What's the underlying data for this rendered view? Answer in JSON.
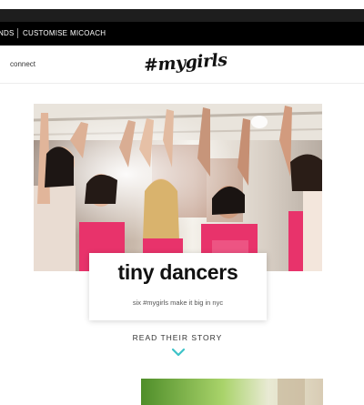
{
  "nav": {
    "items": [
      "NDS",
      "CUSTOMISE",
      "MICOACH"
    ]
  },
  "subheader": {
    "connect_label": "connect",
    "logo_text": "#mygirls"
  },
  "feature": {
    "title": "tiny dancers",
    "subtitle": "six #mygirls make it big in nyc",
    "cta_label": "READ THEIR STORY",
    "cta_icon": "chevron-down-icon",
    "accent_color": "#3ec3c8"
  },
  "colors": {
    "nav_bg": "#000000",
    "jersey_pink": "#e8336b"
  }
}
